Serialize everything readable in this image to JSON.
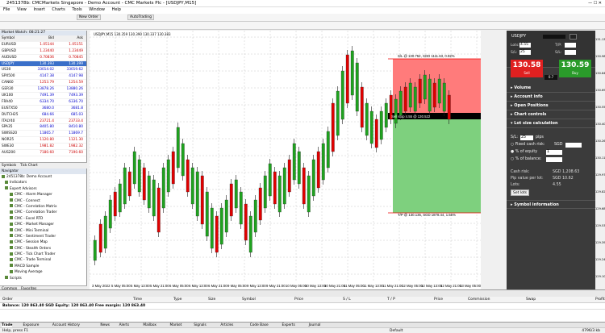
{
  "window": {
    "title": "2451378b: CMCMarkets Singapore - Demo Account - CMC Markets Plc - [USDJPY,M15]"
  },
  "menu": [
    "File",
    "View",
    "Insert",
    "Charts",
    "Tools",
    "Window",
    "Help"
  ],
  "toolbar": {
    "new_order": "New Order",
    "auto_trading": "AutoTrading"
  },
  "market_watch": {
    "title": "Market Watch: 08:21:27",
    "columns": [
      "Symbol",
      "Bid",
      "Ask"
    ],
    "rows": [
      {
        "s": "EURUSD",
        "b": "1.05144",
        "a": "1.05151",
        "up": false
      },
      {
        "s": "GBPUSD",
        "b": "1.23440",
        "a": "1.23449",
        "up": false
      },
      {
        "s": "AUDUSD",
        "b": "0.70836",
        "a": "0.70845",
        "up": false
      },
      {
        "s": "USDJPY",
        "b": "130.393",
        "a": "130.399",
        "up": true,
        "sel": true
      },
      {
        "s": "US30",
        "b": "33014.02",
        "a": "33019.62",
        "up": true
      },
      {
        "s": "SPX500",
        "b": "4147.38",
        "a": "4147.98",
        "up": true
      },
      {
        "s": "CAN60",
        "b": "1253.79",
        "a": "1254.59",
        "up": false
      },
      {
        "s": "GER30",
        "b": "13878.26",
        "a": "13880.26",
        "up": true
      },
      {
        "s": "UK100",
        "b": "7491.39",
        "a": "7493.39",
        "up": true
      },
      {
        "s": "FRA40",
        "b": "6334.70",
        "a": "6336.70",
        "up": true
      },
      {
        "s": "EUSTX50",
        "b": "3680.0",
        "a": "3681.8",
        "up": true
      },
      {
        "s": "DUTCH25",
        "b": "684.66",
        "a": "685.03",
        "up": true
      },
      {
        "s": "ITALY40",
        "b": "23721.4",
        "a": "23733.4",
        "up": false
      },
      {
        "s": "SPA35",
        "b": "8405.80",
        "a": "8410.80",
        "up": true
      },
      {
        "s": "SWISS20",
        "b": "11865.7",
        "a": "11869.7",
        "up": true
      },
      {
        "s": "NOR25",
        "b": "1120.80",
        "a": "1121.30",
        "up": false
      },
      {
        "s": "SWE30",
        "b": "1981.82",
        "a": "1982.32",
        "up": false
      },
      {
        "s": "AUS200",
        "b": "7180.60",
        "a": "7190.60",
        "up": false
      }
    ],
    "tabs": [
      "Symbols",
      "Tick Chart"
    ]
  },
  "navigator": {
    "title": "Navigator",
    "items": [
      "2451378b: Demo Account",
      "Indicators",
      "Expert Advisors",
      "CMC - Alarm Manager",
      "CMC - Connect",
      "CMC - Correlation Matrix",
      "CMC - Correlation Trader",
      "CMC - Excel RTD",
      "CMC - Market Manager",
      "CMC - Mini Terminal",
      "CMC - Sentiment Trader",
      "CMC - Session Map",
      "CMC - Stealth Orders",
      "CMC - Tick Chart Trader",
      "CMC - Trade Terminal",
      "MACD Sample",
      "Moving Average",
      "Scripts"
    ],
    "tabs": [
      "Common",
      "Favorites"
    ]
  },
  "chart": {
    "header": "USDJPY,M15  130.359 130.390 130.337 130.383",
    "sl_label": "S/L @ 130.752, SGD 1111.63, 0.92%",
    "sell_label": "Sell stop 4.55 @ 130.522",
    "tp_label": "T/P @ 130.135, SGD 1878.44, 1.55%",
    "x_labels": [
      "3 May 2022",
      "5 May 05:00",
      "5 May 13:00",
      "5 May 21:00",
      "6 May 05:00",
      "6 May 13:00",
      "6 May 21:00",
      "9 May 05:00",
      "9 May 13:00",
      "9 May 21:00",
      "10 May 05:00",
      "10 May 13:00",
      "10 May 21:00",
      "11 May 05:00",
      "11 May 13:00",
      "11 May 21:00",
      "12 May 05:00",
      "12 May 13:00",
      "12 May 21:00",
      "13 May 05:00"
    ],
    "y_labels": [
      "131.130",
      "130.985",
      "130.840",
      "130.695",
      "130.550",
      "130.405",
      "130.260",
      "130.115",
      "129.970",
      "129.825",
      "129.680",
      "129.535",
      "129.390",
      "129.245",
      "129.100"
    ],
    "colors": {
      "bull": "#1fa31f",
      "bear": "#e00000",
      "sl": "#ff7b7b",
      "tp": "#7ed07e",
      "stripe": "#5ec25e",
      "stripe_red": "#e83030"
    }
  },
  "panel": {
    "symbol": "USDJPY",
    "lots_label": "Lots:",
    "lots": "4.55",
    "tp_label": "T/P:",
    "sl_label": "S/L:",
    "sl": "25",
    "sell": "130.58",
    "sell_label": "Sell",
    "buy": "130.59",
    "buy_label": "Buy",
    "spread": "0.7",
    "sections": [
      "Volume",
      "Account info",
      "Open Positions",
      "Chart controls",
      "Lot size calculation"
    ],
    "lot_calc": {
      "sl_label": "S/L:",
      "sl": "25",
      "pips": "pips",
      "fixed": "Fixed cash risk:",
      "fixed_unit": "SGD",
      "equity": "% of equity",
      "equity_val": "1",
      "balance": "% of balance:"
    },
    "results": [
      {
        "k": "Cash risk:",
        "v": "SGD 1,208.63"
      },
      {
        "k": "Pip value per lot:",
        "v": "SGD 10.62"
      },
      {
        "k": "Lots:",
        "v": "4.55"
      }
    ],
    "set_lots": "Set lots",
    "symbol_info": "Symbol information"
  },
  "terminal": {
    "columns": [
      "Order",
      "Time",
      "Type",
      "Size",
      "Symbol",
      "Price",
      "S / L",
      "T / P",
      "Price",
      "Commission",
      "Swap",
      "Profit"
    ],
    "balance": "Balance: 120 863.40 SGD  Equity: 120 863.40  Free margin: 120 863.40",
    "tabs": [
      "Trade",
      "Exposure",
      "Account History",
      "News",
      "Alerts",
      "Mailbox",
      "Market",
      "Signals",
      "Articles",
      "Code Base",
      "Experts",
      "Journal"
    ],
    "mailbox_badge": "6"
  },
  "status": {
    "help": "Help, press F1",
    "profile": "Default",
    "traffic": "4796/3 kb"
  }
}
